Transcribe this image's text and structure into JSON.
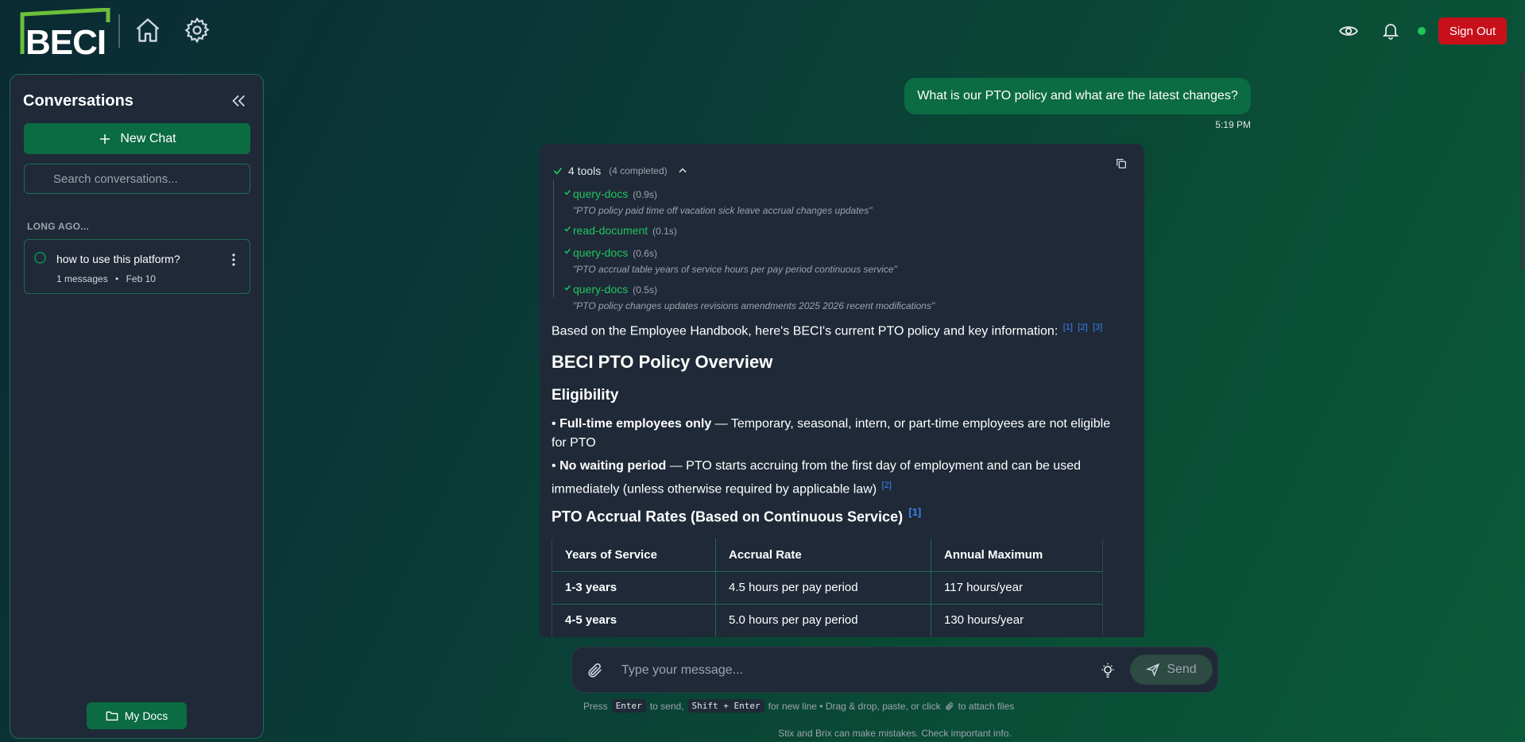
{
  "header": {
    "logo_text": "BECI",
    "sign_out_label": "Sign Out"
  },
  "sidebar": {
    "title": "Conversations",
    "new_chat_label": "New Chat",
    "search_placeholder": "Search conversations...",
    "section_label": "LONG AGO...",
    "conversations": [
      {
        "title": "how to use this platform?",
        "messages": "1 messages",
        "separator": "•",
        "date": "Feb 10"
      }
    ],
    "my_docs_label": "My Docs"
  },
  "chat": {
    "user_message": "What is our PTO policy and what are the latest changes?",
    "user_time": "5:19 PM",
    "tools": {
      "summary": "4 tools",
      "status": "(4 completed)",
      "items": [
        {
          "name": "query-docs",
          "time": "(0.9s)",
          "query": "\"PTO policy paid time off vacation sick leave accrual changes updates\""
        },
        {
          "name": "read-document",
          "time": "(0.1s)",
          "query": ""
        },
        {
          "name": "query-docs",
          "time": "(0.6s)",
          "query": "\"PTO accrual table years of service hours per pay period continuous service\""
        },
        {
          "name": "query-docs",
          "time": "(0.5s)",
          "query": "\"PTO policy changes updates revisions amendments 2025 2026 recent modifications\""
        }
      ]
    },
    "intro": "Based on the Employee Handbook, here's BECI's current PTO policy and key information:",
    "intro_cites": [
      "[1]",
      "[2]",
      "[3]"
    ],
    "heading": "BECI PTO Policy Overview",
    "eligibility_heading": "Eligibility",
    "bullet1_bold": "Full-time employees only",
    "bullet1_text": " — Temporary, seasonal, intern, or part-time employees are not eligible for PTO",
    "bullet2_bold": "No waiting period",
    "bullet2_text": " — PTO starts accruing from the first day of employment and can be used immediately (unless otherwise required by applicable law)",
    "bullet2_cite": "[2]",
    "bullet_char": "•",
    "accrual_heading": "PTO Accrual Rates",
    "accrual_sub": " (Based on Continuous Service)",
    "accrual_cite": "[1]",
    "table": {
      "headers": [
        "Years of Service",
        "Accrual Rate",
        "Annual Maximum"
      ],
      "rows": [
        [
          "1-3 years",
          "4.5 hours per pay period",
          "117 hours/year"
        ],
        [
          "4-5 years",
          "5.0 hours per pay period",
          "130 hours/year"
        ]
      ]
    }
  },
  "composer": {
    "placeholder": "Type your message...",
    "send_label": "Send",
    "hint_press": "Press",
    "hint_enter": "Enter",
    "hint_to_send": "to send,",
    "hint_shift_enter": "Shift + Enter",
    "hint_rest": "for new line • Drag & drop, paste, or click",
    "hint_attach": "to attach files",
    "disclaimer": "Stix and Brix can make mistakes. Check important info."
  },
  "colors": {
    "accent_green": "#0b6b43",
    "success_green": "#22c55e",
    "danger_red": "#c8101a",
    "citation_blue": "#3b82f6",
    "panel_bg": "#1f2937"
  }
}
